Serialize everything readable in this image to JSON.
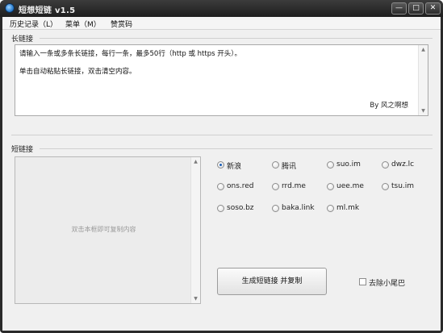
{
  "window": {
    "title": "短想短链 v1.5",
    "minimize_glyph": "—",
    "maximize_glyph": "□",
    "close_glyph": "✕"
  },
  "menu": {
    "items": [
      {
        "label": "历史记录（L）"
      },
      {
        "label": "菜单（M）"
      },
      {
        "label": "赞赏码"
      }
    ]
  },
  "long_link": {
    "label": "长链接",
    "instruction": "请输入一条或多条长链接，每行一条，最多50行（http 或 https 开头）。",
    "hint": "单击自动粘贴长链接，双击清空内容。",
    "signature": "By 风之啊想"
  },
  "short_link": {
    "label": "短链接",
    "copy_hint": "双击本框即可复制内容"
  },
  "services": {
    "selected": "新浪",
    "options": [
      "新浪",
      "腾讯",
      "suo.im",
      "dwz.lc",
      "ons.red",
      "rrd.me",
      "uee.me",
      "tsu.im",
      "soso.bz",
      "baka.link",
      "ml.mk"
    ]
  },
  "actions": {
    "generate_label": "生成短链接 并复制",
    "remove_tail_label": "去除小尾巴",
    "remove_tail_checked": false
  },
  "colors": {
    "titlebar": "#2a2a2a",
    "client_bg": "#f0f0f0",
    "radio_selected": "#1c5fb8"
  }
}
